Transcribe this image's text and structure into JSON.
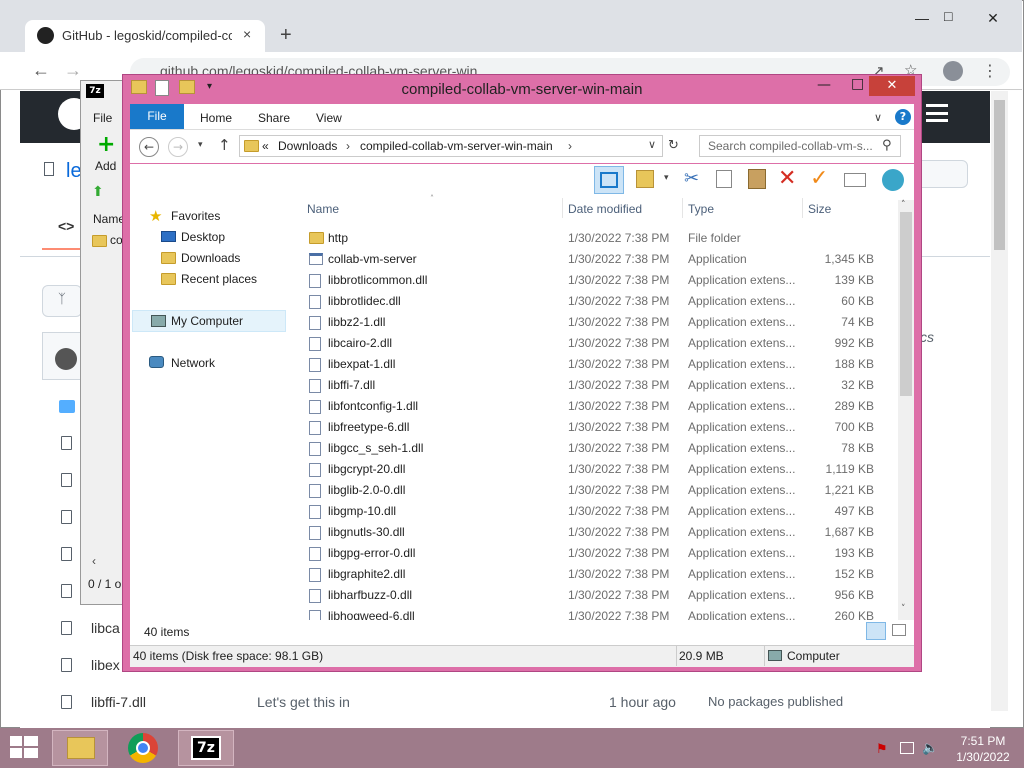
{
  "chrome": {
    "tab_title": "GitHub - legoskid/compiled-coll...",
    "close_tab": "×",
    "new_tab": "+",
    "url": "github.com/legoskid/compiled-collab-vm-server-win"
  },
  "github": {
    "repo_prefix": "le",
    "code_glyph": "<>",
    "partial_name_1": "libca",
    "partial_name_2": "libex",
    "bottom_row": {
      "name": "libffi-7.dll",
      "message": "Let's get this in",
      "time": "1 hour ago"
    },
    "side_text": "cs",
    "no_packages": "No packages published"
  },
  "sevenzip": {
    "file_menu": "File",
    "add_label": "Add",
    "name_col": "Name",
    "folder_item": "co",
    "status": "0 / 1 o"
  },
  "explorer": {
    "title": "compiled-collab-vm-server-win-main",
    "tabs": [
      "File",
      "Home",
      "Share",
      "View"
    ],
    "breadcrumb_prefix": "«",
    "breadcrumb": [
      "Downloads",
      "compiled-collab-vm-server-win-main"
    ],
    "search_placeholder": "Search compiled-collab-vm-s...",
    "columns": {
      "name": "Name",
      "date": "Date modified",
      "type": "Type",
      "size": "Size"
    },
    "nav": {
      "favorites": "Favorites",
      "desktop": "Desktop",
      "downloads": "Downloads",
      "recent": "Recent places",
      "computer": "My Computer",
      "network": "Network"
    },
    "files": [
      {
        "name": "http",
        "date": "1/30/2022 7:38 PM",
        "type": "File folder",
        "size": "",
        "kind": "folder"
      },
      {
        "name": "collab-vm-server",
        "date": "1/30/2022 7:38 PM",
        "type": "Application",
        "size": "1,345 KB",
        "kind": "app"
      },
      {
        "name": "libbrotlicommon.dll",
        "date": "1/30/2022 7:38 PM",
        "type": "Application extens...",
        "size": "139 KB",
        "kind": "dll"
      },
      {
        "name": "libbrotlidec.dll",
        "date": "1/30/2022 7:38 PM",
        "type": "Application extens...",
        "size": "60 KB",
        "kind": "dll"
      },
      {
        "name": "libbz2-1.dll",
        "date": "1/30/2022 7:38 PM",
        "type": "Application extens...",
        "size": "74 KB",
        "kind": "dll"
      },
      {
        "name": "libcairo-2.dll",
        "date": "1/30/2022 7:38 PM",
        "type": "Application extens...",
        "size": "992 KB",
        "kind": "dll"
      },
      {
        "name": "libexpat-1.dll",
        "date": "1/30/2022 7:38 PM",
        "type": "Application extens...",
        "size": "188 KB",
        "kind": "dll"
      },
      {
        "name": "libffi-7.dll",
        "date": "1/30/2022 7:38 PM",
        "type": "Application extens...",
        "size": "32 KB",
        "kind": "dll"
      },
      {
        "name": "libfontconfig-1.dll",
        "date": "1/30/2022 7:38 PM",
        "type": "Application extens...",
        "size": "289 KB",
        "kind": "dll"
      },
      {
        "name": "libfreetype-6.dll",
        "date": "1/30/2022 7:38 PM",
        "type": "Application extens...",
        "size": "700 KB",
        "kind": "dll"
      },
      {
        "name": "libgcc_s_seh-1.dll",
        "date": "1/30/2022 7:38 PM",
        "type": "Application extens...",
        "size": "78 KB",
        "kind": "dll"
      },
      {
        "name": "libgcrypt-20.dll",
        "date": "1/30/2022 7:38 PM",
        "type": "Application extens...",
        "size": "1,119 KB",
        "kind": "dll"
      },
      {
        "name": "libglib-2.0-0.dll",
        "date": "1/30/2022 7:38 PM",
        "type": "Application extens...",
        "size": "1,221 KB",
        "kind": "dll"
      },
      {
        "name": "libgmp-10.dll",
        "date": "1/30/2022 7:38 PM",
        "type": "Application extens...",
        "size": "497 KB",
        "kind": "dll"
      },
      {
        "name": "libgnutls-30.dll",
        "date": "1/30/2022 7:38 PM",
        "type": "Application extens...",
        "size": "1,687 KB",
        "kind": "dll"
      },
      {
        "name": "libgpg-error-0.dll",
        "date": "1/30/2022 7:38 PM",
        "type": "Application extens...",
        "size": "193 KB",
        "kind": "dll"
      },
      {
        "name": "libgraphite2.dll",
        "date": "1/30/2022 7:38 PM",
        "type": "Application extens...",
        "size": "152 KB",
        "kind": "dll"
      },
      {
        "name": "libharfbuzz-0.dll",
        "date": "1/30/2022 7:38 PM",
        "type": "Application extens...",
        "size": "956 KB",
        "kind": "dll"
      },
      {
        "name": "libhogweed-6.dll",
        "date": "1/30/2022 7:38 PM",
        "type": "Application extens...",
        "size": "260 KB",
        "kind": "dll"
      }
    ],
    "item_count": "40 items",
    "status_left": "40 items (Disk free space: 98.1 GB)",
    "status_size": "20.9 MB",
    "status_computer": "Computer"
  },
  "taskbar": {
    "time": "7:51 PM",
    "date": "1/30/2022",
    "sevenzip_label": "7z"
  },
  "colors": {
    "window_frame": "#dd6fa8",
    "ribbon_file": "#1979ca",
    "taskbar": "#9e7b8a",
    "desktop": "#7fbcc1"
  }
}
